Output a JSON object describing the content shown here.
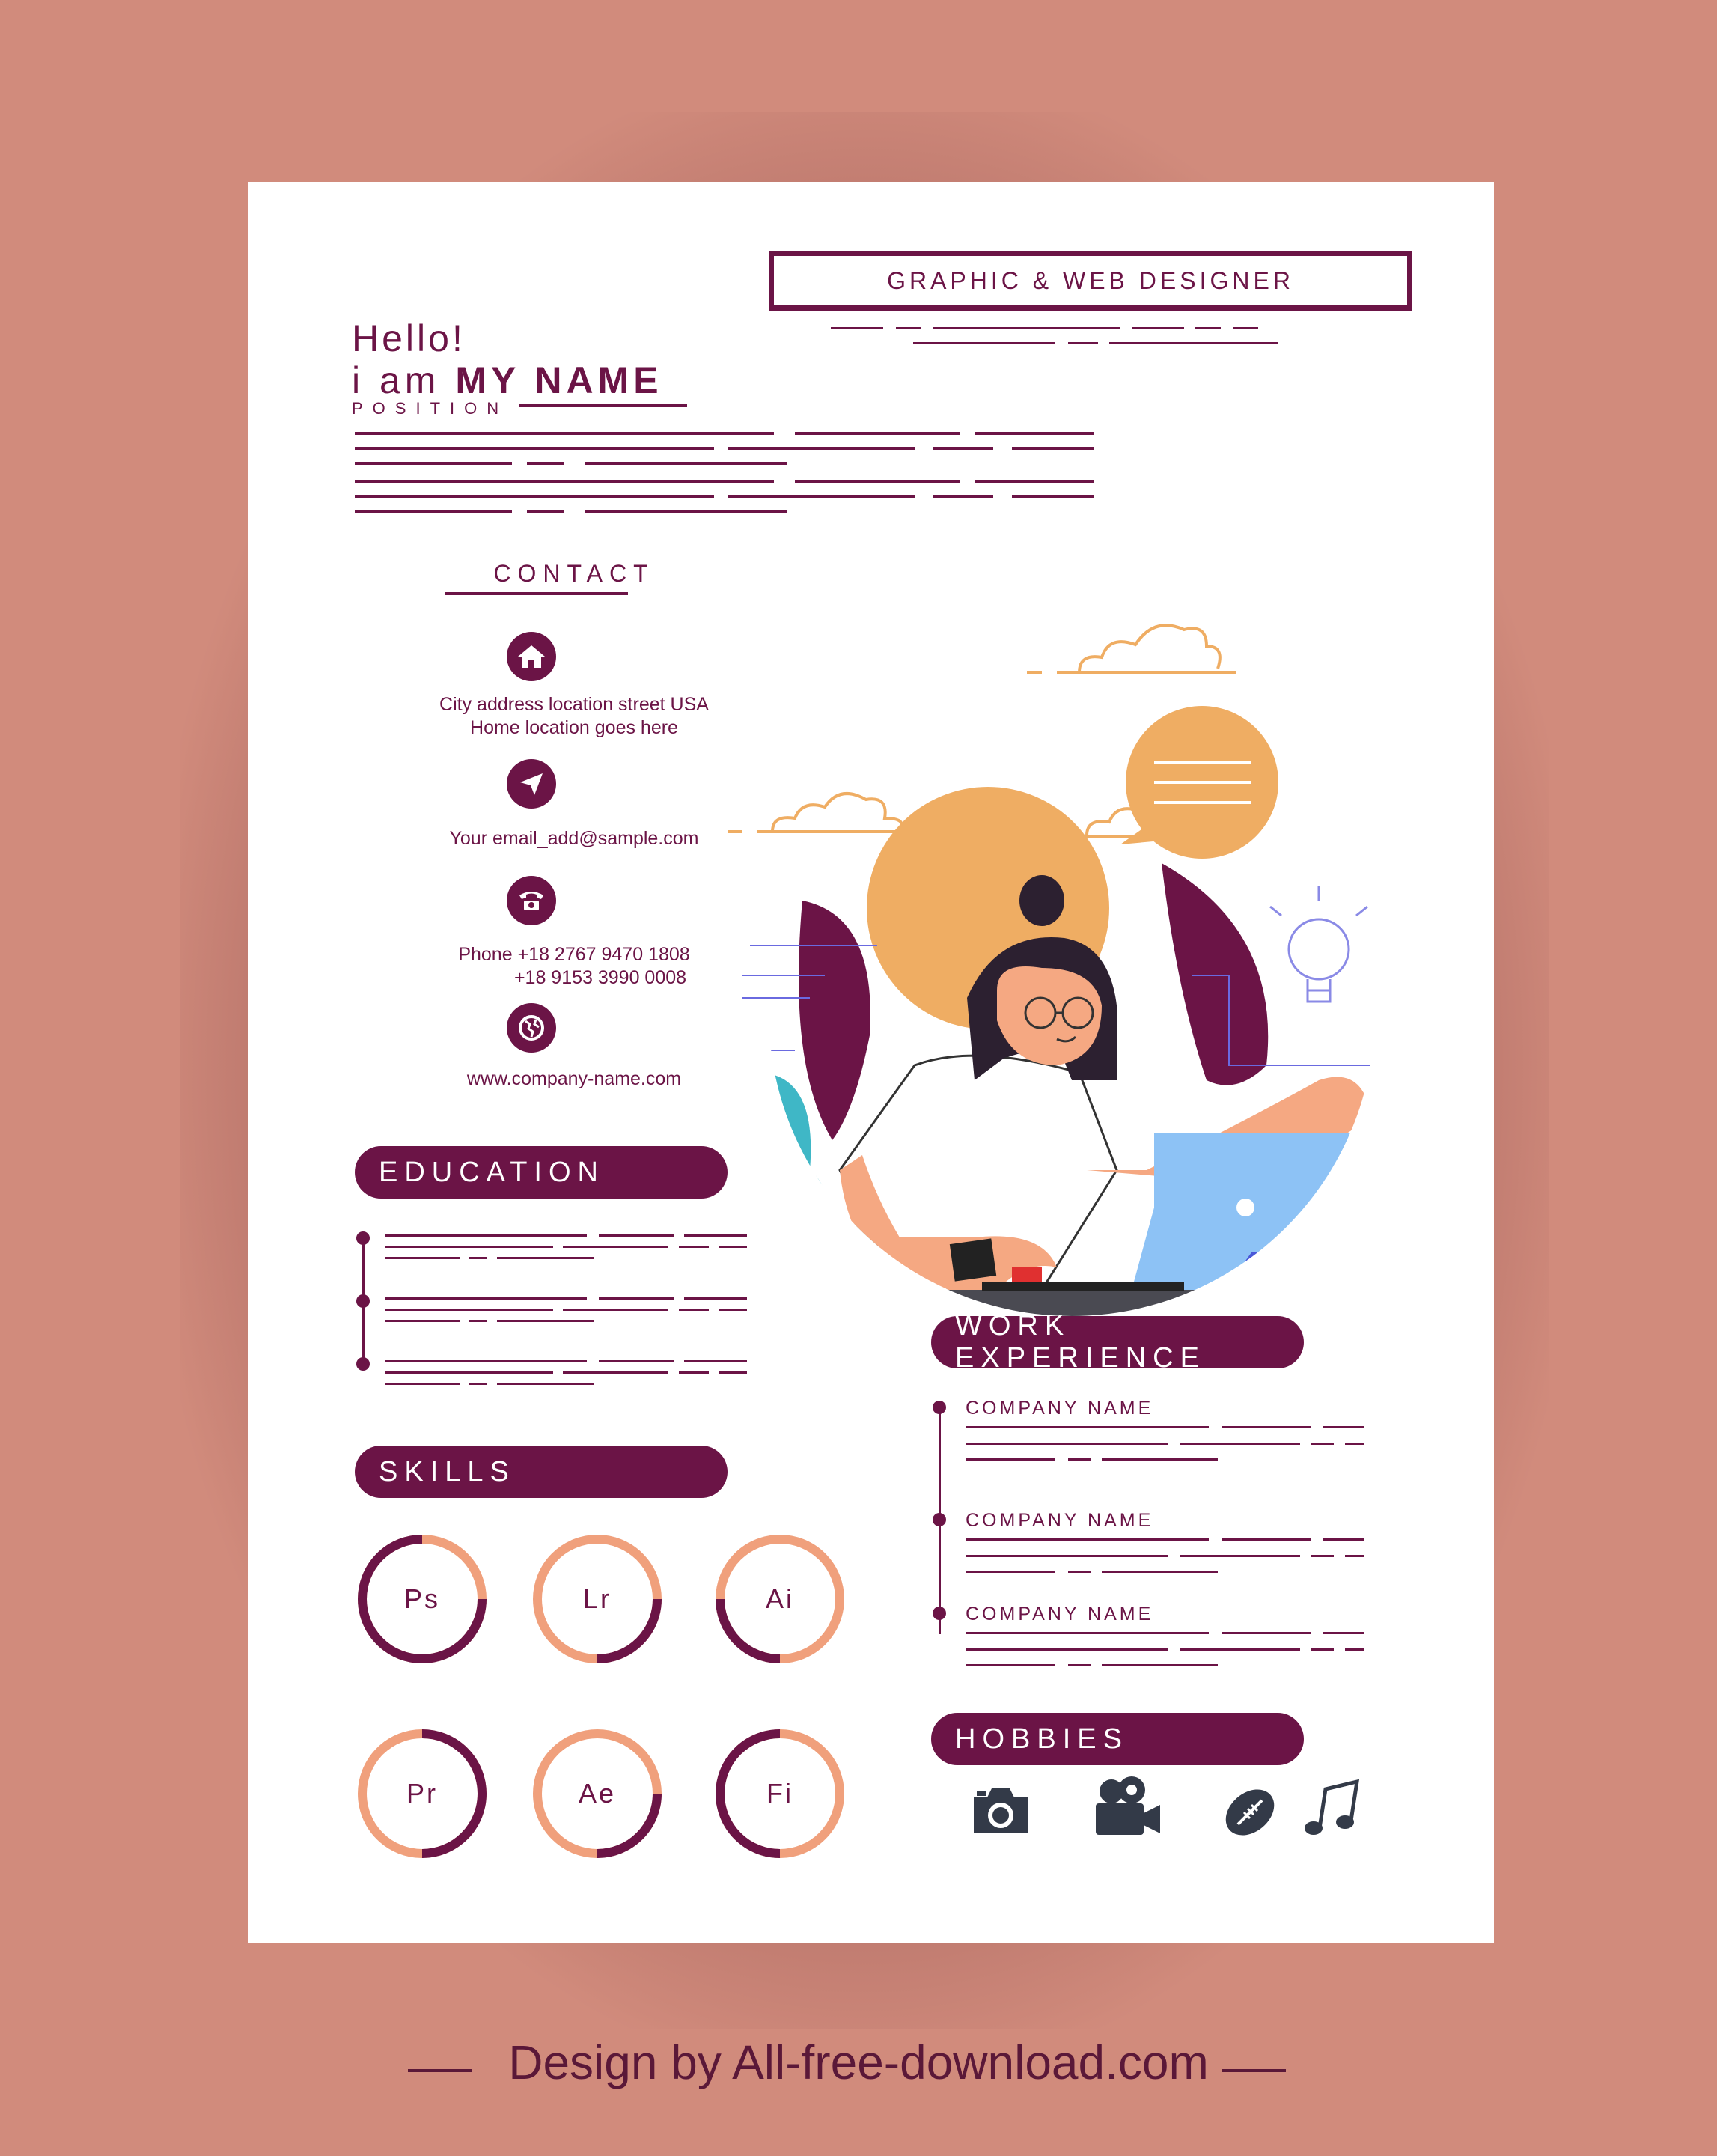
{
  "header": {
    "title_box": "GRAPHIC & WEB DESIGNER",
    "hello": "Hello!",
    "iam": "i am",
    "name": "MY NAME",
    "position": "POSITION"
  },
  "contact": {
    "title": "CONTACT",
    "address_line1": "City address location street USA",
    "address_line2": "Home location goes here",
    "email": "Your email_add@sample.com",
    "phone_line1": "Phone +18 2767 9470 1808",
    "phone_line2": "+18 9153 3990 0008",
    "website": "www.company-name.com"
  },
  "education": {
    "title": "EDUCATION"
  },
  "skills": {
    "title": "SKILLS",
    "items": [
      {
        "label": "Ps"
      },
      {
        "label": "Lr"
      },
      {
        "label": "Ai"
      },
      {
        "label": "Pr"
      },
      {
        "label": "Ae"
      },
      {
        "label": "Fi"
      }
    ]
  },
  "work": {
    "title": "WORK EXPERIENCE",
    "companies": [
      "COMPANY NAME",
      "COMPANY NAME",
      "COMPANY NAME"
    ]
  },
  "hobbies": {
    "title": "HOBBIES",
    "icons": [
      "camera-icon",
      "video-camera-icon",
      "football-icon",
      "music-note-icon"
    ]
  },
  "footer": {
    "credit": "Design by All-free-download.com"
  },
  "colors": {
    "primary": "#6b1446",
    "accent": "#f0a07c",
    "background": "#d18b7c",
    "sun": "#efad63"
  }
}
